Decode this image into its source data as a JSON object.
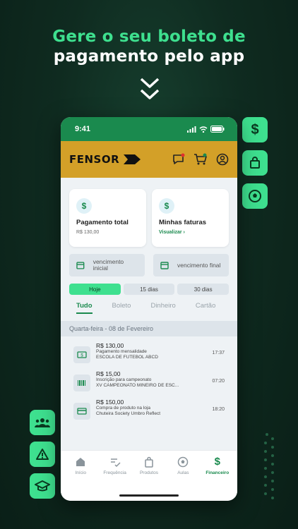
{
  "headline": {
    "line1": "Gere o seu boleto de",
    "line2": "pagamento pelo app"
  },
  "status": {
    "time": "9:41"
  },
  "brand": {
    "name": "FENSOR"
  },
  "cards": [
    {
      "title": "Pagamento total",
      "value": "R$ 130,00",
      "icon": "dollar-icon"
    },
    {
      "title": "Minhas faturas",
      "link": "Visualizar",
      "icon": "dollar-icon"
    }
  ],
  "dates": {
    "start": "vencimento inicial",
    "end": "vencimento final"
  },
  "periods": [
    "Hoje",
    "15 dias",
    "30 dias"
  ],
  "tabs": [
    "Tudo",
    "Boleto",
    "Dinheiro",
    "Cartão"
  ],
  "day_header": "Quarta-feira - 08 de Fevereiro",
  "transactions": [
    {
      "amount": "R$ 130,00",
      "desc1": "Pagamento mensalidade",
      "desc2": "ESCOLA DE FUTEBOL ABCD",
      "time": "17:37",
      "icon": "cash-icon"
    },
    {
      "amount": "R$ 15,00",
      "desc1": "Inscrição para campeonato",
      "desc2": "XV CAMPEONATO MINEIRO DE ESC...",
      "time": "07:20",
      "icon": "barcode-icon"
    },
    {
      "amount": "R$ 150,00",
      "desc1": "Compra de produto na loja",
      "desc2": "Chuteira Society Umbro Reflect",
      "time": "18:20",
      "icon": "card-icon"
    }
  ],
  "nav": [
    {
      "label": "Início",
      "icon": "home-icon"
    },
    {
      "label": "Frequência",
      "icon": "check-list-icon"
    },
    {
      "label": "Produtos",
      "icon": "bag-icon"
    },
    {
      "label": "Aulas",
      "icon": "ball-icon"
    },
    {
      "label": "Financeiro",
      "icon": "dollar-icon",
      "active": true
    }
  ],
  "colors": {
    "accent": "#3ee08f",
    "primary": "#1a8a4e",
    "brand_bar": "#d3a028",
    "background": "#0f2b20"
  }
}
